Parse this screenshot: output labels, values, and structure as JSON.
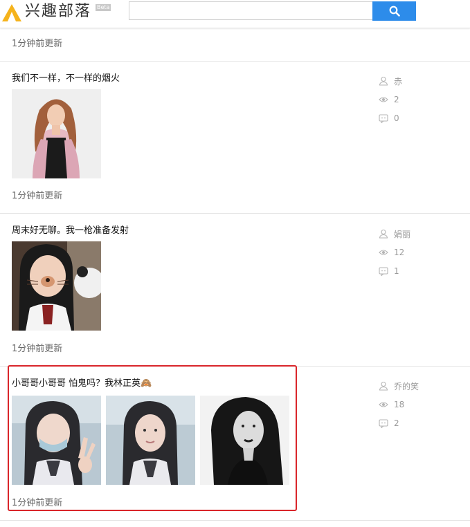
{
  "header": {
    "logo_text": "兴趣部落",
    "logo_badge": "Beta",
    "search_placeholder": "",
    "search_button_icon": "search-icon"
  },
  "top_updated": "1分钟前更新",
  "posts": [
    {
      "title": "我们不一样，不一样的烟火",
      "author": "赤",
      "views": "2",
      "comments": "0",
      "updated": "1分钟前更新",
      "images": [
        "woman-pink-blazer-photo"
      ]
    },
    {
      "title": "周末好无聊。我一枪准备发射",
      "author": "娟丽",
      "views": "12",
      "comments": "1",
      "updated": "1分钟前更新",
      "images": [
        "girl-cat-filter-selfie"
      ]
    },
    {
      "title": "小哥哥小哥哥 怕鬼吗？我林正英",
      "title_emoji": "🙈",
      "author": "乔的笑",
      "views": "18",
      "comments": "2",
      "updated": "1分钟前更新",
      "images": [
        "girl-peace-sign-selfie",
        "girl-selfie",
        "girl-black-white-portrait"
      ],
      "highlighted": true
    }
  ],
  "colors": {
    "accent": "#2d8cea",
    "logo": "#f5b31c",
    "highlight_border": "#d9252a",
    "meta_text": "#9a9a9a"
  }
}
